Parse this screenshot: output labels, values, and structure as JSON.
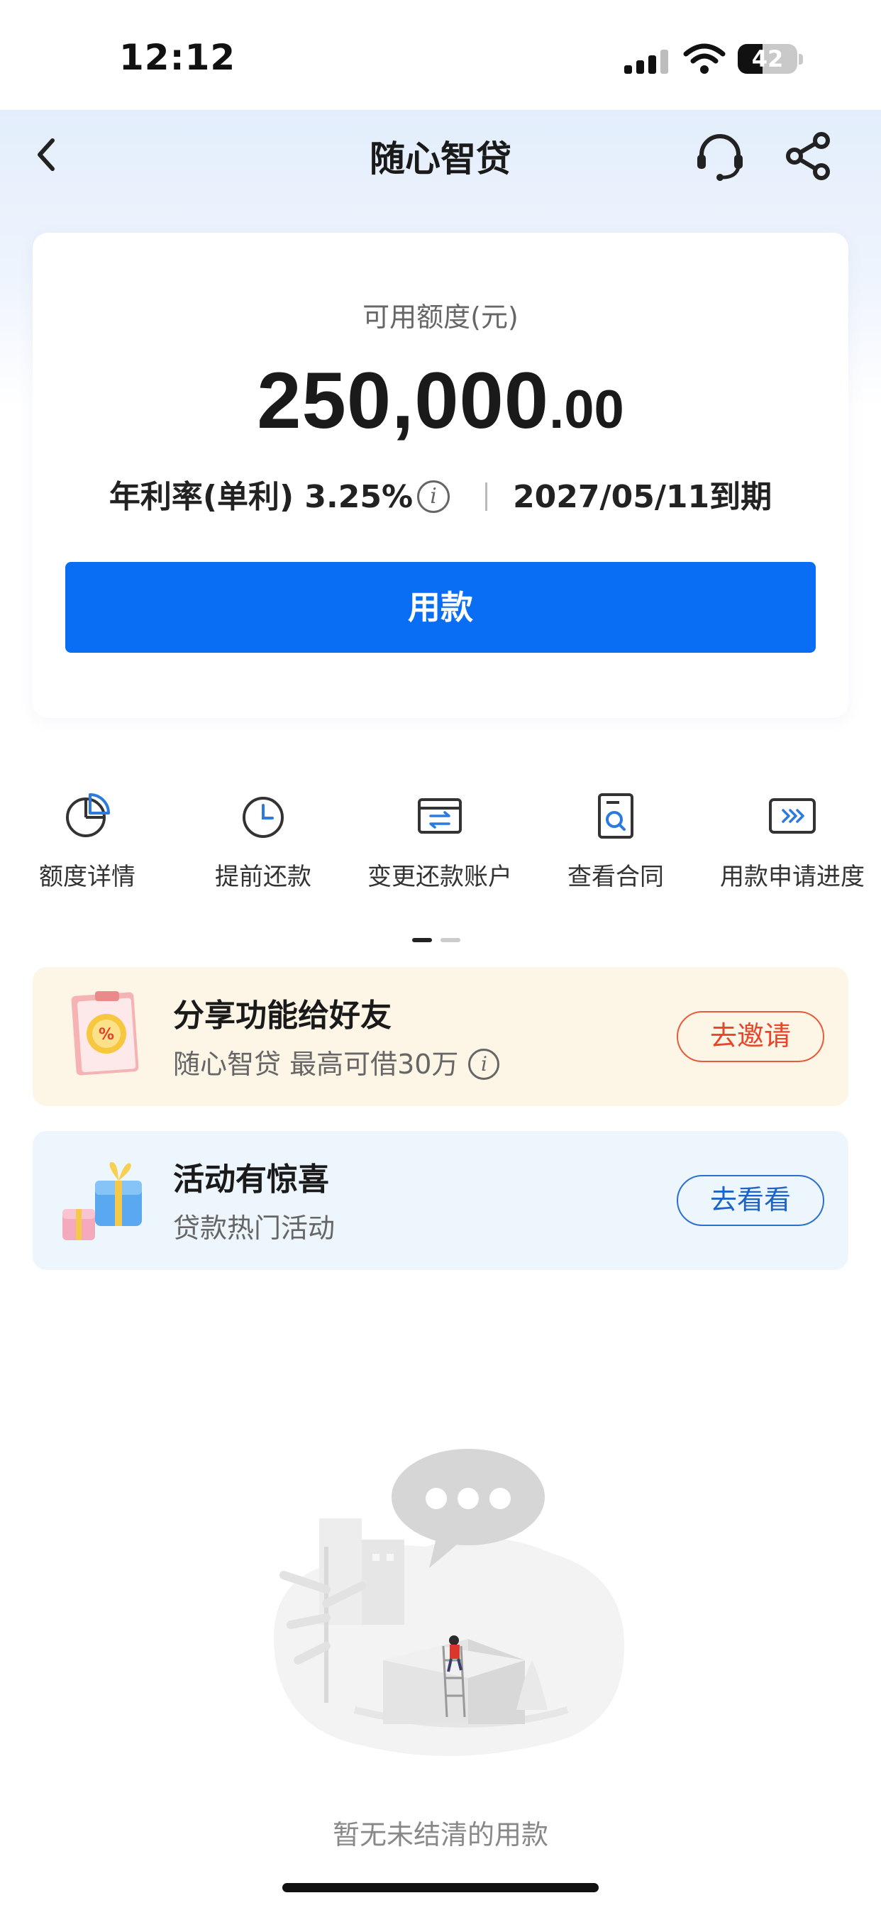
{
  "status_bar": {
    "time": "12:12",
    "battery": "42",
    "battery_level": 0.42
  },
  "nav": {
    "title": "随心智贷",
    "back_icon": "chevron-left-icon",
    "service_icon": "headset-icon",
    "share_icon": "share-icon"
  },
  "quota": {
    "label": "可用额度(元)",
    "amount_int": "250,000",
    "amount_dec": ".00",
    "rate_text": "年利率(单利) 3.25%",
    "info_glyph": "i",
    "due_text": "2027/05/11到期",
    "button_label": "用款"
  },
  "actions": [
    {
      "label": "额度详情",
      "icon": "pie-chart-icon"
    },
    {
      "label": "提前还款",
      "icon": "clock-icon"
    },
    {
      "label": "变更还款账户",
      "icon": "card-swap-icon"
    },
    {
      "label": "查看合同",
      "icon": "document-search-icon"
    },
    {
      "label": "用款申请进度",
      "icon": "progress-arrows-icon"
    }
  ],
  "banners": [
    {
      "title": "分享功能给好友",
      "subtitle": "随心智贷 最高可借30万",
      "button": "去邀请",
      "icon": "discount-clipboard-icon"
    },
    {
      "title": "活动有惊喜",
      "subtitle": "贷款热门活动",
      "button": "去看看",
      "icon": "gift-box-icon"
    }
  ],
  "empty_state": {
    "text": "暂无未结清的用款",
    "illustration": "empty-state-illustration"
  },
  "colors": {
    "primary": "#0a6ef5",
    "invite": "#e8452a",
    "view": "#1d63c8",
    "banner_warm": "#fdf5e6",
    "banner_cool": "#edf5fd"
  }
}
